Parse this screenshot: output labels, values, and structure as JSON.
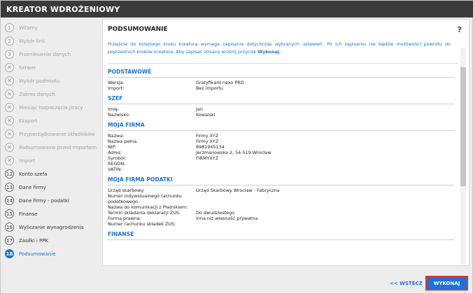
{
  "window": {
    "title": "KREATOR WDROŻENIOWY"
  },
  "sidebar": {
    "steps": [
      {
        "num": "1",
        "label": "Witamy",
        "state": "done"
      },
      {
        "num": "2",
        "label": "Wybór linii",
        "state": "done"
      },
      {
        "num": "3",
        "label": "Przeniesienie danych",
        "state": "done"
      },
      {
        "num": "✕",
        "label": "Serwer",
        "state": "skipped"
      },
      {
        "num": "✕",
        "label": "Wybór podmiotu",
        "state": "skipped"
      },
      {
        "num": "✕",
        "label": "Zakres danych",
        "state": "skipped"
      },
      {
        "num": "✕",
        "label": "Miesiąc rozpoczęcia pracy",
        "state": "skipped"
      },
      {
        "num": "✕",
        "label": "Eksport",
        "state": "skipped"
      },
      {
        "num": "✕",
        "label": "Przyporządkowanie składników",
        "state": "skipped"
      },
      {
        "num": "✕",
        "label": "Podsumowanie przed importem",
        "state": "skipped"
      },
      {
        "num": "✕",
        "label": "Import",
        "state": "skipped"
      },
      {
        "num": "12",
        "label": "Konto szefa",
        "state": "active"
      },
      {
        "num": "13",
        "label": "Dane firmy",
        "state": "active"
      },
      {
        "num": "14",
        "label": "Dane firmy - podatki",
        "state": "active"
      },
      {
        "num": "15",
        "label": "Finanse",
        "state": "active"
      },
      {
        "num": "16",
        "label": "Wyliczanie wynagrodzenia",
        "state": "active"
      },
      {
        "num": "17",
        "label": "Zasiłki i PPK",
        "state": "active"
      },
      {
        "num": "18",
        "label": "Podsumowanie",
        "state": "current"
      }
    ]
  },
  "main": {
    "title": "PODSUMOWANIE",
    "help": "?",
    "intro_text": "Przejście do kolejnego kroku kreatora wymaga zapisania dotychczas wybranych ustawień. Po ich zapisaniu nie będzie możliwości powrotu do poprzednich kroków kreatora. Aby zapisać zmiany wciśnij przycisk ",
    "intro_bold": "Wykonaj.",
    "sections": [
      {
        "title": "PODSTAWOWE",
        "rows": [
          {
            "k": "Wersja:",
            "v": "Gratyfikant nexo PRO"
          },
          {
            "k": "Import:",
            "v": "Bez importu"
          }
        ]
      },
      {
        "title": "SZEF",
        "rows": [
          {
            "k": "Imię:",
            "v": "Jan"
          },
          {
            "k": "Nazwisko:",
            "v": "Kowalski"
          }
        ]
      },
      {
        "title": "MOJA FIRMA",
        "rows": [
          {
            "k": "Nazwa:",
            "v": "Firmy XYZ"
          },
          {
            "k": "Nazwa pełna:",
            "v": "Firmy XYZ"
          },
          {
            "k": "NIP:",
            "v": "8981945134"
          },
          {
            "k": "Adres:",
            "v": "Jerzmanowska 2, 54-519 Wrocław"
          },
          {
            "k": "Symbol:",
            "v": "FIRMYXYZ"
          },
          {
            "k": "REGON:",
            "v": ""
          },
          {
            "k": "VATIN:",
            "v": ""
          }
        ]
      },
      {
        "title": "MOJA FIRMA PODATKI",
        "rows": [
          {
            "k": "Urząd skarbowy:",
            "v": "Urząd Skarbowy Wrocław - Fabryczna"
          },
          {
            "k": "Numer indywidualnego rachunku",
            "v": ""
          },
          {
            "k": "podatkowego:",
            "v": ""
          },
          {
            "k": "Nazwa do komunikacji z Płatnikiem:",
            "v": ""
          },
          {
            "k": "Termin składania deklaracji ZUS:",
            "v": "Do dwudziestego"
          },
          {
            "k": "Forma prawna:",
            "v": "Inna niż własność prywatna"
          },
          {
            "k": "Numer rachunku składek ZUS:",
            "v": ""
          }
        ]
      },
      {
        "title": "FINANSE",
        "rows": []
      }
    ]
  },
  "footer": {
    "back_label": "<< WSTECZ",
    "execute_label": "WYKONAJ"
  }
}
